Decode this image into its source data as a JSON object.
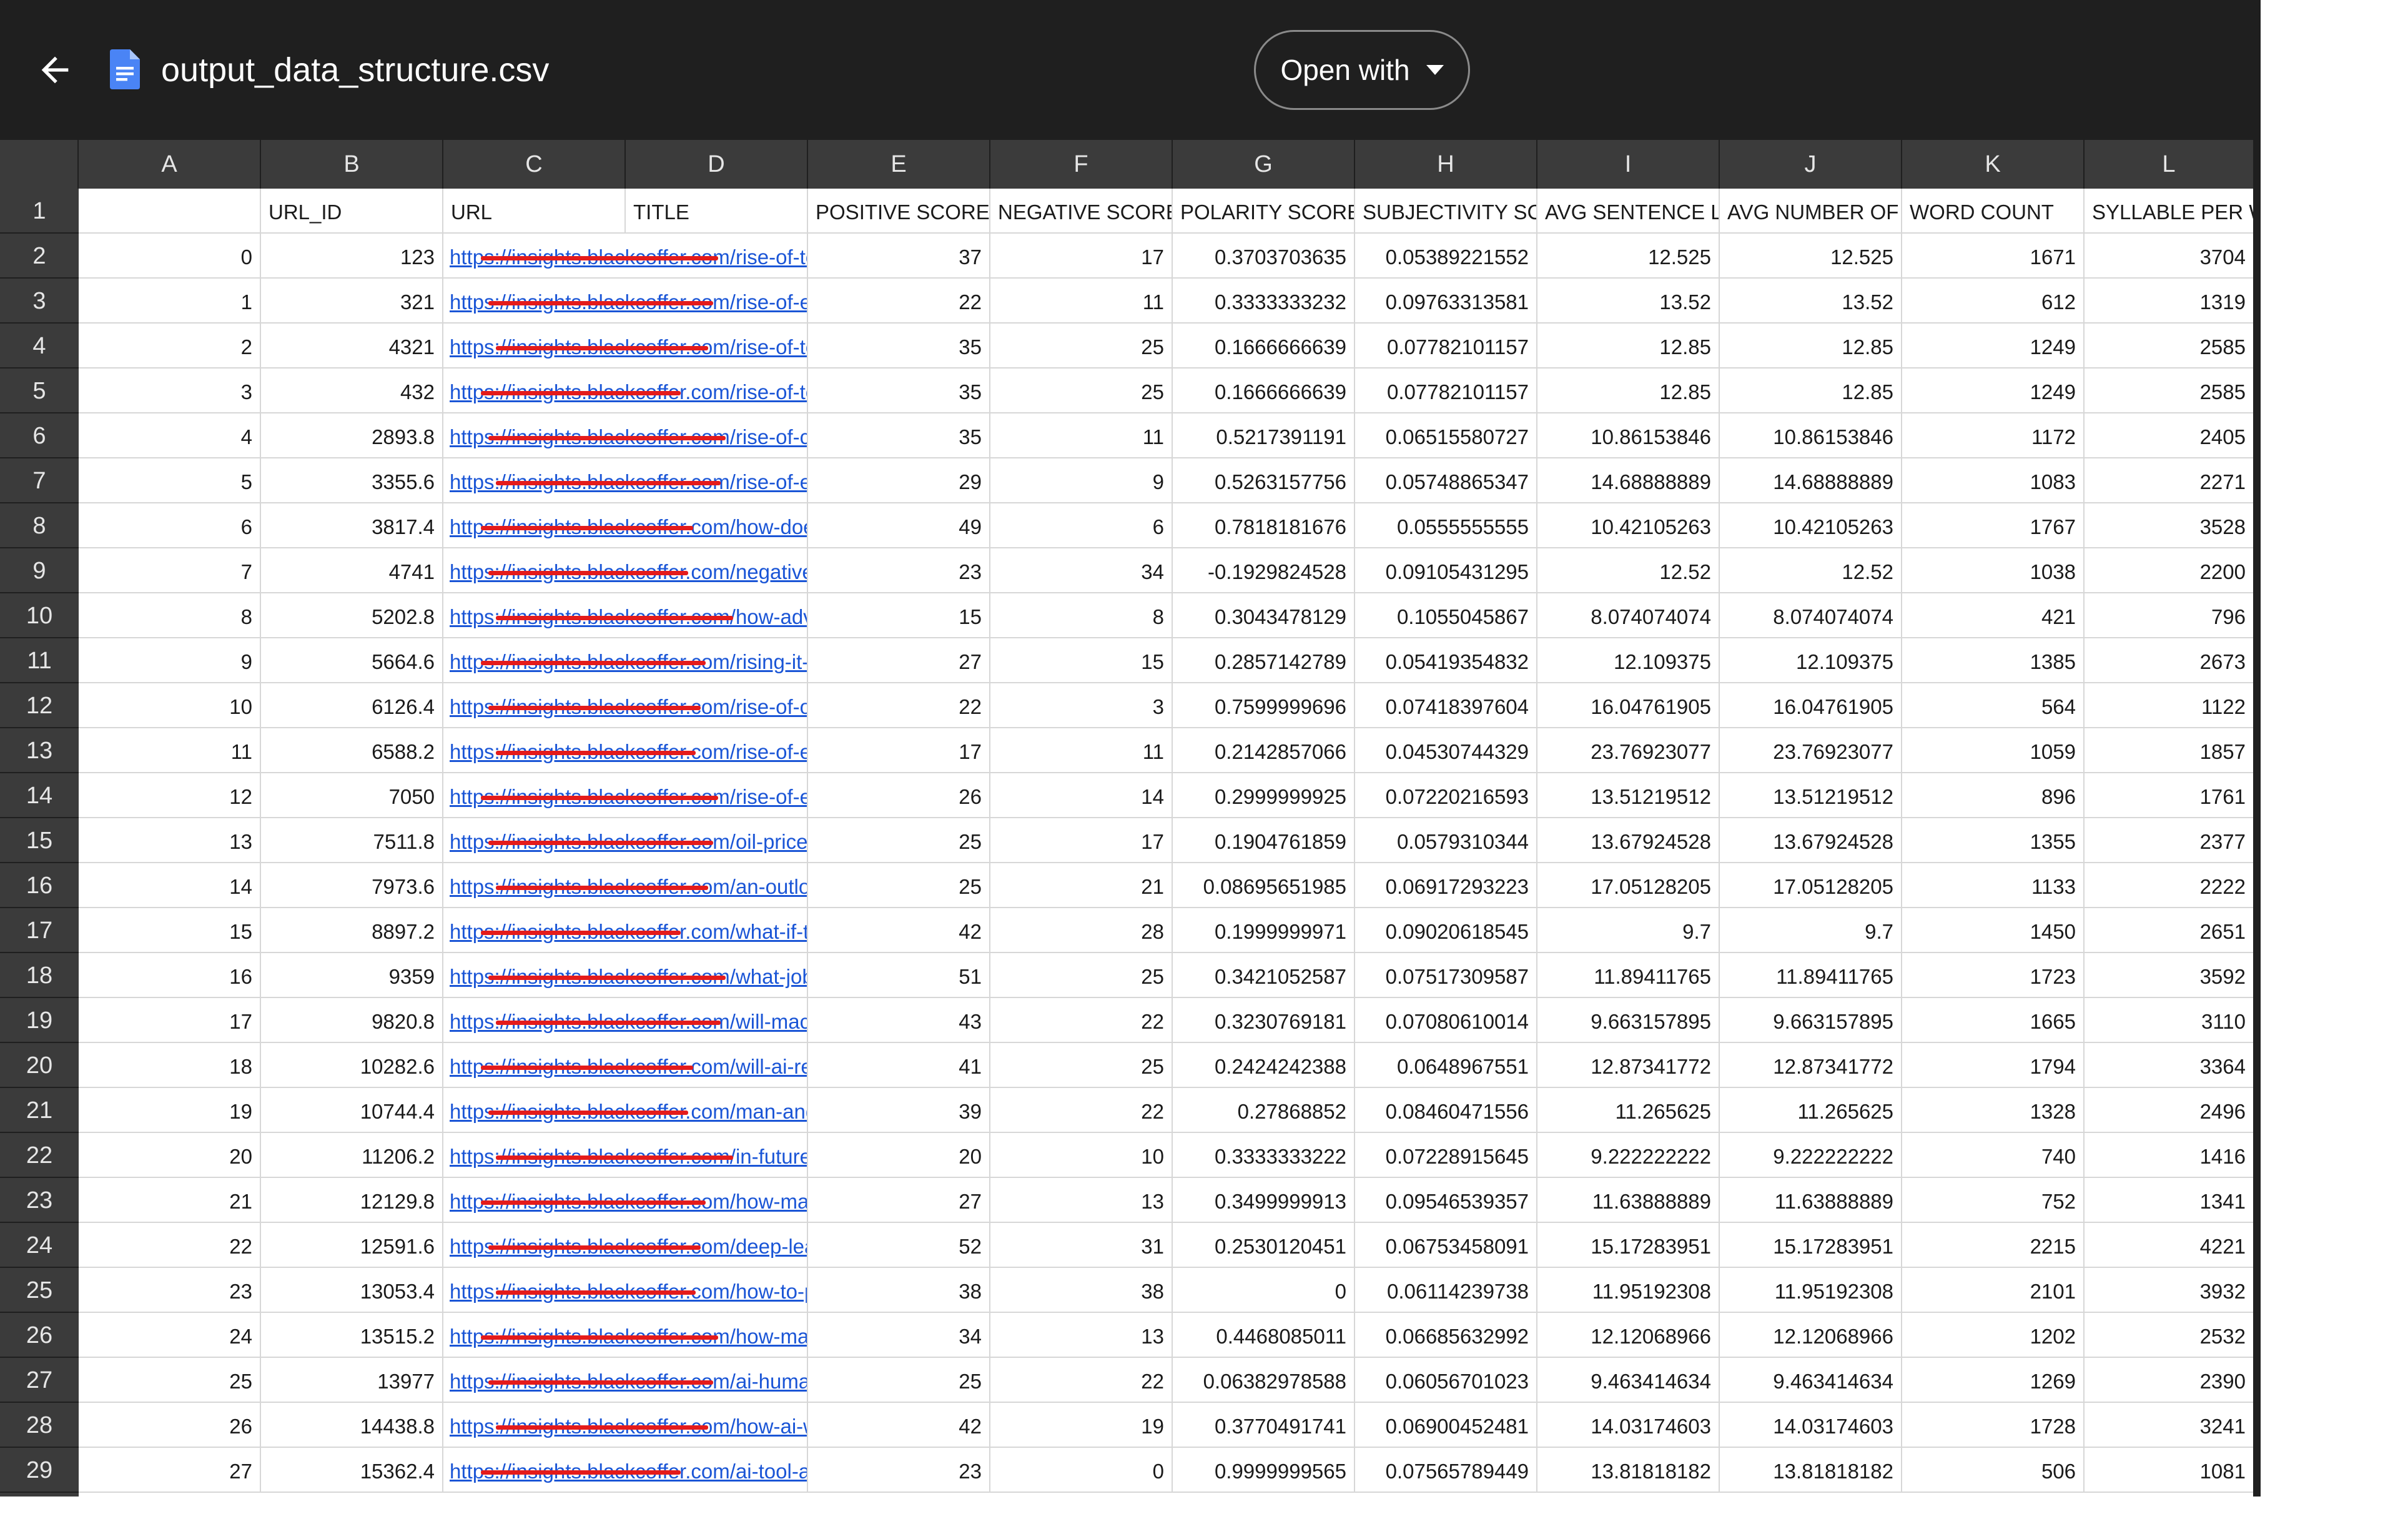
{
  "topbar": {
    "file_name": "output_data_structure.csv",
    "open_with_label": "Open with",
    "back_icon": "arrow-left-icon",
    "file_icon": "google-docs-file-icon",
    "dropdown_icon": "caret-down-icon"
  },
  "sheet": {
    "column_letters": [
      "A",
      "B",
      "C",
      "D",
      "E",
      "F",
      "G",
      "H",
      "I",
      "J",
      "K",
      "L"
    ],
    "row_numbers": [
      "1",
      "2",
      "3",
      "4",
      "5",
      "6",
      "7",
      "8",
      "9",
      "10",
      "11",
      "12",
      "13",
      "14",
      "15",
      "16",
      "17",
      "18",
      "19",
      "20",
      "21",
      "22",
      "23",
      "24",
      "25",
      "26",
      "27",
      "28",
      "29"
    ],
    "header": [
      "",
      "URL_ID",
      "URL",
      "TITLE",
      "POSITIVE SCORE",
      "NEGATIVE SCORE",
      "POLARITY SCORE",
      "SUBJECTIVITY SCC",
      "AVG SENTENCE LE",
      "AVG NUMBER OF W",
      "WORD COUNT",
      "SYLLABLE PER WO"
    ],
    "rows": [
      {
        "idx": "0",
        "url_id": "123",
        "url": "https://insights.blackcoffer.com/rise-of-tele",
        "pos": "37",
        "neg": "17",
        "pol": "0.3703703635",
        "subj": "0.05389221552",
        "avg_sent": "12.525",
        "avg_words": "12.525",
        "wc": "1671",
        "syl": "3704"
      },
      {
        "idx": "1",
        "url_id": "321",
        "url": "https://insights.blackcoffer.com/rise-of-e-he",
        "pos": "22",
        "neg": "11",
        "pol": "0.3333333232",
        "subj": "0.09763313581",
        "avg_sent": "13.52",
        "avg_words": "13.52",
        "wc": "612",
        "syl": "1319"
      },
      {
        "idx": "2",
        "url_id": "4321",
        "url": "https://insights.blackcoffer.com/rise-of-tele",
        "pos": "35",
        "neg": "25",
        "pol": "0.1666666639",
        "subj": "0.07782101157",
        "avg_sent": "12.85",
        "avg_words": "12.85",
        "wc": "1249",
        "syl": "2585"
      },
      {
        "idx": "3",
        "url_id": "432",
        "url": "https://insights.blackcoffer.com/rise-of-tele",
        "pos": "35",
        "neg": "25",
        "pol": "0.1666666639",
        "subj": "0.07782101157",
        "avg_sent": "12.85",
        "avg_words": "12.85",
        "wc": "1249",
        "syl": "2585"
      },
      {
        "idx": "4",
        "url_id": "2893.8",
        "url": "https://insights.blackcoffer.com/rise-of-cha",
        "pos": "35",
        "neg": "11",
        "pol": "0.5217391191",
        "subj": "0.06515580727",
        "avg_sent": "10.86153846",
        "avg_words": "10.86153846",
        "wc": "1172",
        "syl": "2405"
      },
      {
        "idx": "5",
        "url_id": "3355.6",
        "url": "https://insights.blackcoffer.com/rise-of-e-he",
        "pos": "29",
        "neg": "9",
        "pol": "0.5263157756",
        "subj": "0.05748865347",
        "avg_sent": "14.68888889",
        "avg_words": "14.68888889",
        "wc": "1083",
        "syl": "2271"
      },
      {
        "idx": "6",
        "url_id": "3817.4",
        "url": "https://insights.blackcoffer.com/how-does-",
        "pos": "49",
        "neg": "6",
        "pol": "0.7818181676",
        "subj": "0.0555555555",
        "avg_sent": "10.42105263",
        "avg_words": "10.42105263",
        "wc": "1767",
        "syl": "3528"
      },
      {
        "idx": "7",
        "url_id": "4741",
        "url": "https://insights.blackcoffer.com/negative-e",
        "pos": "23",
        "neg": "34",
        "pol": "-0.1929824528",
        "subj": "0.09105431295",
        "avg_sent": "12.52",
        "avg_words": "12.52",
        "wc": "1038",
        "syl": "2200"
      },
      {
        "idx": "8",
        "url_id": "5202.8",
        "url": "https://insights.blackcoffer.com/how-adver",
        "pos": "15",
        "neg": "8",
        "pol": "0.3043478129",
        "subj": "0.1055045867",
        "avg_sent": "8.074074074",
        "avg_words": "8.074074074",
        "wc": "421",
        "syl": "796"
      },
      {
        "idx": "9",
        "url_id": "5664.6",
        "url": "https://insights.blackcoffer.com/rising-it-citi",
        "pos": "27",
        "neg": "15",
        "pol": "0.2857142789",
        "subj": "0.05419354832",
        "avg_sent": "12.109375",
        "avg_words": "12.109375",
        "wc": "1385",
        "syl": "2673"
      },
      {
        "idx": "10",
        "url_id": "6126.4",
        "url": "https://insights.blackcoffer.com/rise-of-ott-p",
        "pos": "22",
        "neg": "3",
        "pol": "0.7599999696",
        "subj": "0.07418397604",
        "avg_sent": "16.04761905",
        "avg_words": "16.04761905",
        "wc": "564",
        "syl": "1122"
      },
      {
        "idx": "11",
        "url_id": "6588.2",
        "url": "https://insights.blackcoffer.com/rise-of-elec",
        "pos": "17",
        "neg": "11",
        "pol": "0.2142857066",
        "subj": "0.04530744329",
        "avg_sent": "23.76923077",
        "avg_words": "23.76923077",
        "wc": "1059",
        "syl": "1857"
      },
      {
        "idx": "12",
        "url_id": "7050",
        "url": "https://insights.blackcoffer.com/rise-of-elec",
        "pos": "26",
        "neg": "14",
        "pol": "0.2999999925",
        "subj": "0.07220216593",
        "avg_sent": "13.51219512",
        "avg_words": "13.51219512",
        "wc": "896",
        "syl": "1761"
      },
      {
        "idx": "13",
        "url_id": "7511.8",
        "url": "https://insights.blackcoffer.com/oil-prices-b",
        "pos": "25",
        "neg": "17",
        "pol": "0.1904761859",
        "subj": "0.0579310344",
        "avg_sent": "13.67924528",
        "avg_words": "13.67924528",
        "wc": "1355",
        "syl": "2377"
      },
      {
        "idx": "14",
        "url_id": "7973.6",
        "url": "https://insights.blackcoffer.com/an-outlook",
        "pos": "25",
        "neg": "21",
        "pol": "0.08695651985",
        "subj": "0.06917293223",
        "avg_sent": "17.05128205",
        "avg_words": "17.05128205",
        "wc": "1133",
        "syl": "2222"
      },
      {
        "idx": "15",
        "url_id": "8897.2",
        "url": "https://insights.blackcoffer.com/what-if-the-",
        "pos": "42",
        "neg": "28",
        "pol": "0.1999999971",
        "subj": "0.09020618545",
        "avg_sent": "9.7",
        "avg_words": "9.7",
        "wc": "1450",
        "syl": "2651"
      },
      {
        "idx": "16",
        "url_id": "9359",
        "url": "https://insights.blackcoffer.com/what-jobs-v",
        "pos": "51",
        "neg": "25",
        "pol": "0.3421052587",
        "subj": "0.07517309587",
        "avg_sent": "11.89411765",
        "avg_words": "11.89411765",
        "wc": "1723",
        "syl": "3592"
      },
      {
        "idx": "17",
        "url_id": "9820.8",
        "url": "https://insights.blackcoffer.com/will-machi",
        "pos": "43",
        "neg": "22",
        "pol": "0.3230769181",
        "subj": "0.07080610014",
        "avg_sent": "9.663157895",
        "avg_words": "9.663157895",
        "wc": "1665",
        "syl": "3110"
      },
      {
        "idx": "18",
        "url_id": "10282.6",
        "url": "https://insights.blackcoffer.com/will-ai-repl",
        "pos": "41",
        "neg": "25",
        "pol": "0.2424242388",
        "subj": "0.0648967551",
        "avg_sent": "12.87341772",
        "avg_words": "12.87341772",
        "wc": "1794",
        "syl": "3364"
      },
      {
        "idx": "19",
        "url_id": "10744.4",
        "url": "https://insights.blackcoffer.com/man-and-m",
        "pos": "39",
        "neg": "22",
        "pol": "0.27868852",
        "subj": "0.08460471556",
        "avg_sent": "11.265625",
        "avg_words": "11.265625",
        "wc": "1328",
        "syl": "2496"
      },
      {
        "idx": "20",
        "url_id": "11206.2",
        "url": "https://insights.blackcoffer.com/in-future-or",
        "pos": "20",
        "neg": "10",
        "pol": "0.3333333222",
        "subj": "0.07228915645",
        "avg_sent": "9.222222222",
        "avg_words": "9.222222222",
        "wc": "740",
        "syl": "1416"
      },
      {
        "idx": "21",
        "url_id": "12129.8",
        "url": "https://insights.blackcoffer.com/how-machi",
        "pos": "27",
        "neg": "13",
        "pol": "0.3499999913",
        "subj": "0.09546539357",
        "avg_sent": "11.63888889",
        "avg_words": "11.63888889",
        "wc": "752",
        "syl": "1341"
      },
      {
        "idx": "22",
        "url_id": "12591.6",
        "url": "https://insights.blackcoffer.com/deep-learn",
        "pos": "52",
        "neg": "31",
        "pol": "0.2530120451",
        "subj": "0.06753458091",
        "avg_sent": "15.17283951",
        "avg_words": "15.17283951",
        "wc": "2215",
        "syl": "4221"
      },
      {
        "idx": "23",
        "url_id": "13053.4",
        "url": "https://insights.blackcoffer.com/how-to-pro",
        "pos": "38",
        "neg": "38",
        "pol": "0",
        "subj": "0.06114239738",
        "avg_sent": "11.95192308",
        "avg_words": "11.95192308",
        "wc": "2101",
        "syl": "3932"
      },
      {
        "idx": "24",
        "url_id": "13515.2",
        "url": "https://insights.blackcoffer.com/how-mach",
        "pos": "34",
        "neg": "13",
        "pol": "0.4468085011",
        "subj": "0.06685632992",
        "avg_sent": "12.12068966",
        "avg_words": "12.12068966",
        "wc": "1202",
        "syl": "2532"
      },
      {
        "idx": "25",
        "url_id": "13977",
        "url": "https://insights.blackcoffer.com/ai-human-",
        "pos": "25",
        "neg": "22",
        "pol": "0.06382978588",
        "subj": "0.06056701023",
        "avg_sent": "9.463414634",
        "avg_words": "9.463414634",
        "wc": "1269",
        "syl": "2390"
      },
      {
        "idx": "26",
        "url_id": "14438.8",
        "url": "https://insights.blackcoffer.com/how-ai-will",
        "pos": "42",
        "neg": "19",
        "pol": "0.3770491741",
        "subj": "0.06900452481",
        "avg_sent": "14.03174603",
        "avg_words": "14.03174603",
        "wc": "1728",
        "syl": "3241"
      },
      {
        "idx": "27",
        "url_id": "15362.4",
        "url": "https://insights.blackcoffer.com/ai-tool-alex",
        "pos": "23",
        "neg": "0",
        "pol": "0.9999999565",
        "subj": "0.07565789449",
        "avg_sent": "13.81818182",
        "avg_words": "13.81818182",
        "wc": "506",
        "syl": "1081"
      }
    ]
  }
}
